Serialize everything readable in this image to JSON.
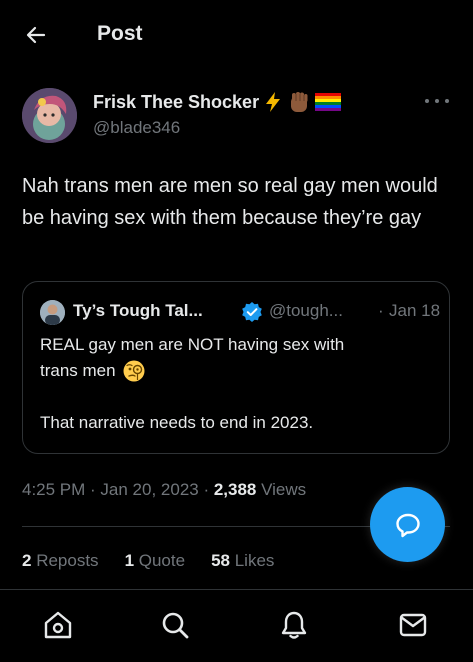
{
  "header": {
    "title": "Post",
    "back_icon": "arrow-left-icon"
  },
  "post": {
    "author_name": "Frisk Thee Shocker",
    "author_emojis": [
      "lightning-emoji",
      "raised-fist-emoji",
      "rainbow-flag-emoji"
    ],
    "handle": "@blade346",
    "text": "Nah trans men are men so real gay men would be having sex with them because they’re gay",
    "time": "4:25 PM",
    "sep1": " · ",
    "date": "Jan 20, 2023",
    "sep2": " · ",
    "views_count": "2,388",
    "views_label": " Views"
  },
  "quote": {
    "author_name": "Ty’s Tough Tal...",
    "handle": "@tough...",
    "dot": "·",
    "date": "Jan 18",
    "line1": "REAL gay men are NOT having sex with",
    "line2": "trans men",
    "line3": "That narrative needs to end in 2023.",
    "emoji": "face-with-monocle-emoji"
  },
  "stats": {
    "reposts_count": "2",
    "reposts_label": " Reposts",
    "quotes_count": "1",
    "quotes_label": " Quote",
    "likes_count": "58",
    "likes_label": " Likes"
  },
  "nav": [
    "home-icon",
    "search-icon",
    "notifications-icon",
    "messages-icon"
  ],
  "colors": {
    "background": "#000000",
    "text": "#e7e9ea",
    "secondary": "#71767b",
    "accent": "#1d9bf0",
    "border": "#2f3336"
  }
}
